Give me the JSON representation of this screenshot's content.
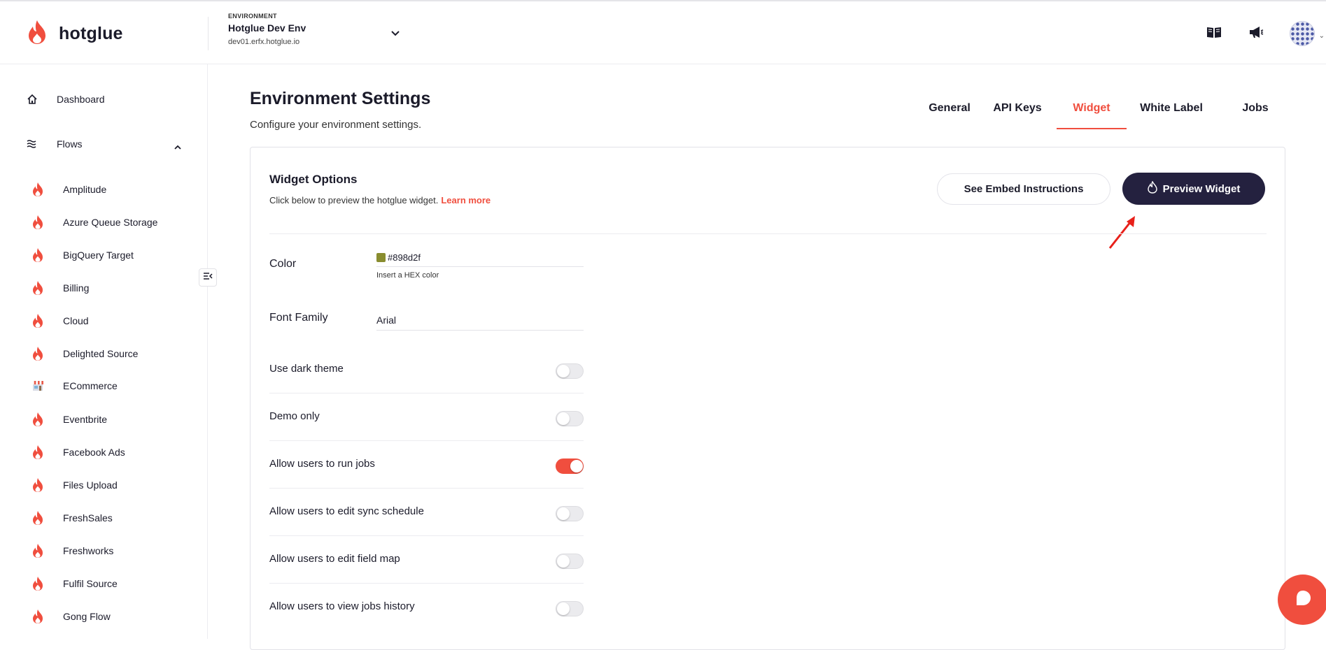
{
  "brand": {
    "name": "hotglue",
    "accent": "#f04e3e"
  },
  "environment": {
    "caption": "ENVIRONMENT",
    "name": "Hotglue Dev Env",
    "host": "dev01.erfx.hotglue.io"
  },
  "header_icons": [
    "book-icon",
    "megaphone-icon",
    "avatar"
  ],
  "sidebar": {
    "nav": [
      {
        "label": "Dashboard",
        "icon": "home-icon"
      },
      {
        "label": "Flows",
        "icon": "flows-icon",
        "expanded": true
      }
    ],
    "flows": [
      {
        "label": "Amplitude",
        "icon": "flame-icon"
      },
      {
        "label": "Azure Queue Storage",
        "icon": "flame-icon"
      },
      {
        "label": "BigQuery Target",
        "icon": "flame-icon"
      },
      {
        "label": "Billing",
        "icon": "flame-icon"
      },
      {
        "label": "Cloud",
        "icon": "flame-icon"
      },
      {
        "label": "Delighted Source",
        "icon": "flame-icon"
      },
      {
        "label": "ECommerce",
        "icon": "store-icon"
      },
      {
        "label": "Eventbrite",
        "icon": "flame-icon"
      },
      {
        "label": "Facebook Ads",
        "icon": "flame-icon"
      },
      {
        "label": "Files Upload",
        "icon": "flame-icon"
      },
      {
        "label": "FreshSales",
        "icon": "flame-icon"
      },
      {
        "label": "Freshworks",
        "icon": "flame-icon"
      },
      {
        "label": "Fulfil Source",
        "icon": "flame-icon"
      },
      {
        "label": "Gong Flow",
        "icon": "flame-icon"
      }
    ]
  },
  "page": {
    "title": "Environment Settings",
    "subtitle": "Configure your environment settings.",
    "tabs": [
      {
        "label": "General",
        "active": false
      },
      {
        "label": "API Keys",
        "active": false
      },
      {
        "label": "Widget",
        "active": true
      },
      {
        "label": "White Label",
        "active": false
      },
      {
        "label": "Jobs",
        "active": false
      }
    ]
  },
  "widget": {
    "title": "Widget Options",
    "description": "Click below to preview the hotglue widget.",
    "learn_more": "Learn more",
    "embed_button": "See Embed Instructions",
    "preview_button": "Preview Widget",
    "color": {
      "label": "Color",
      "value": "#898d2f",
      "hint": "Insert a HEX color",
      "swatch": "#898d2f"
    },
    "font": {
      "label": "Font Family",
      "value": "Arial"
    },
    "toggles": [
      {
        "label": "Use dark theme",
        "on": false
      },
      {
        "label": "Demo only",
        "on": false
      },
      {
        "label": "Allow users to run jobs",
        "on": true
      },
      {
        "label": "Allow users to edit sync schedule",
        "on": false
      },
      {
        "label": "Allow users to edit field map",
        "on": false
      },
      {
        "label": "Allow users to view jobs history",
        "on": false
      }
    ]
  }
}
